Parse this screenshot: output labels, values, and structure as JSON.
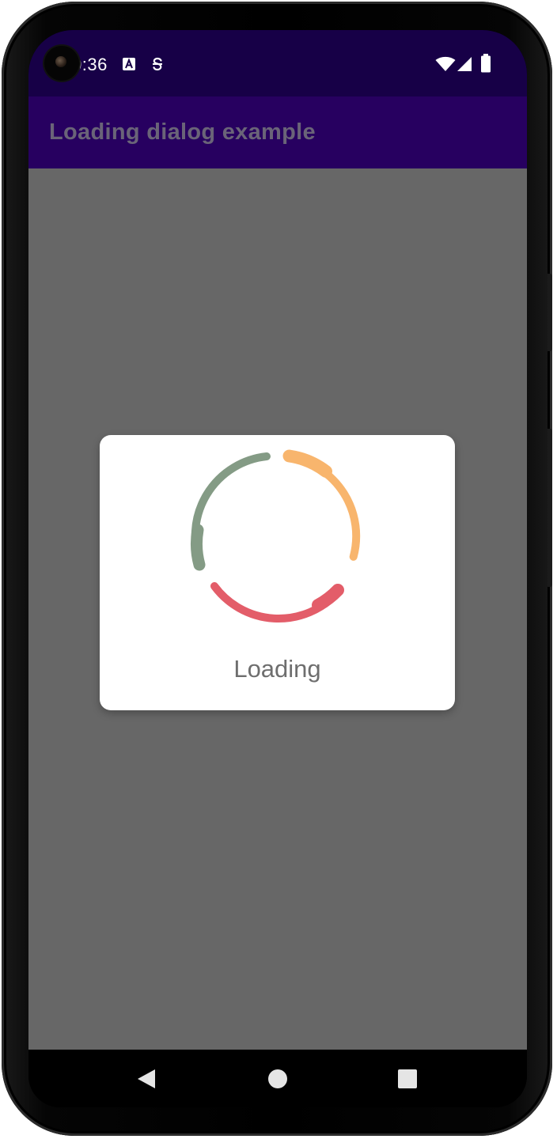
{
  "status_bar": {
    "time": "0:36",
    "left_icons": [
      "accessibility-a-icon",
      "sync-s-icon"
    ],
    "right_icons": [
      "wifi-icon",
      "cell-signal-icon",
      "battery-icon"
    ]
  },
  "app_bar": {
    "title": "Loading dialog example",
    "color": "#270060"
  },
  "dialog": {
    "label": "Loading",
    "spinner_colors": [
      "#f8b56d",
      "#e35d69",
      "#849b85"
    ]
  },
  "nav_bar": {
    "buttons": [
      "back-icon",
      "home-icon",
      "recents-icon"
    ]
  }
}
